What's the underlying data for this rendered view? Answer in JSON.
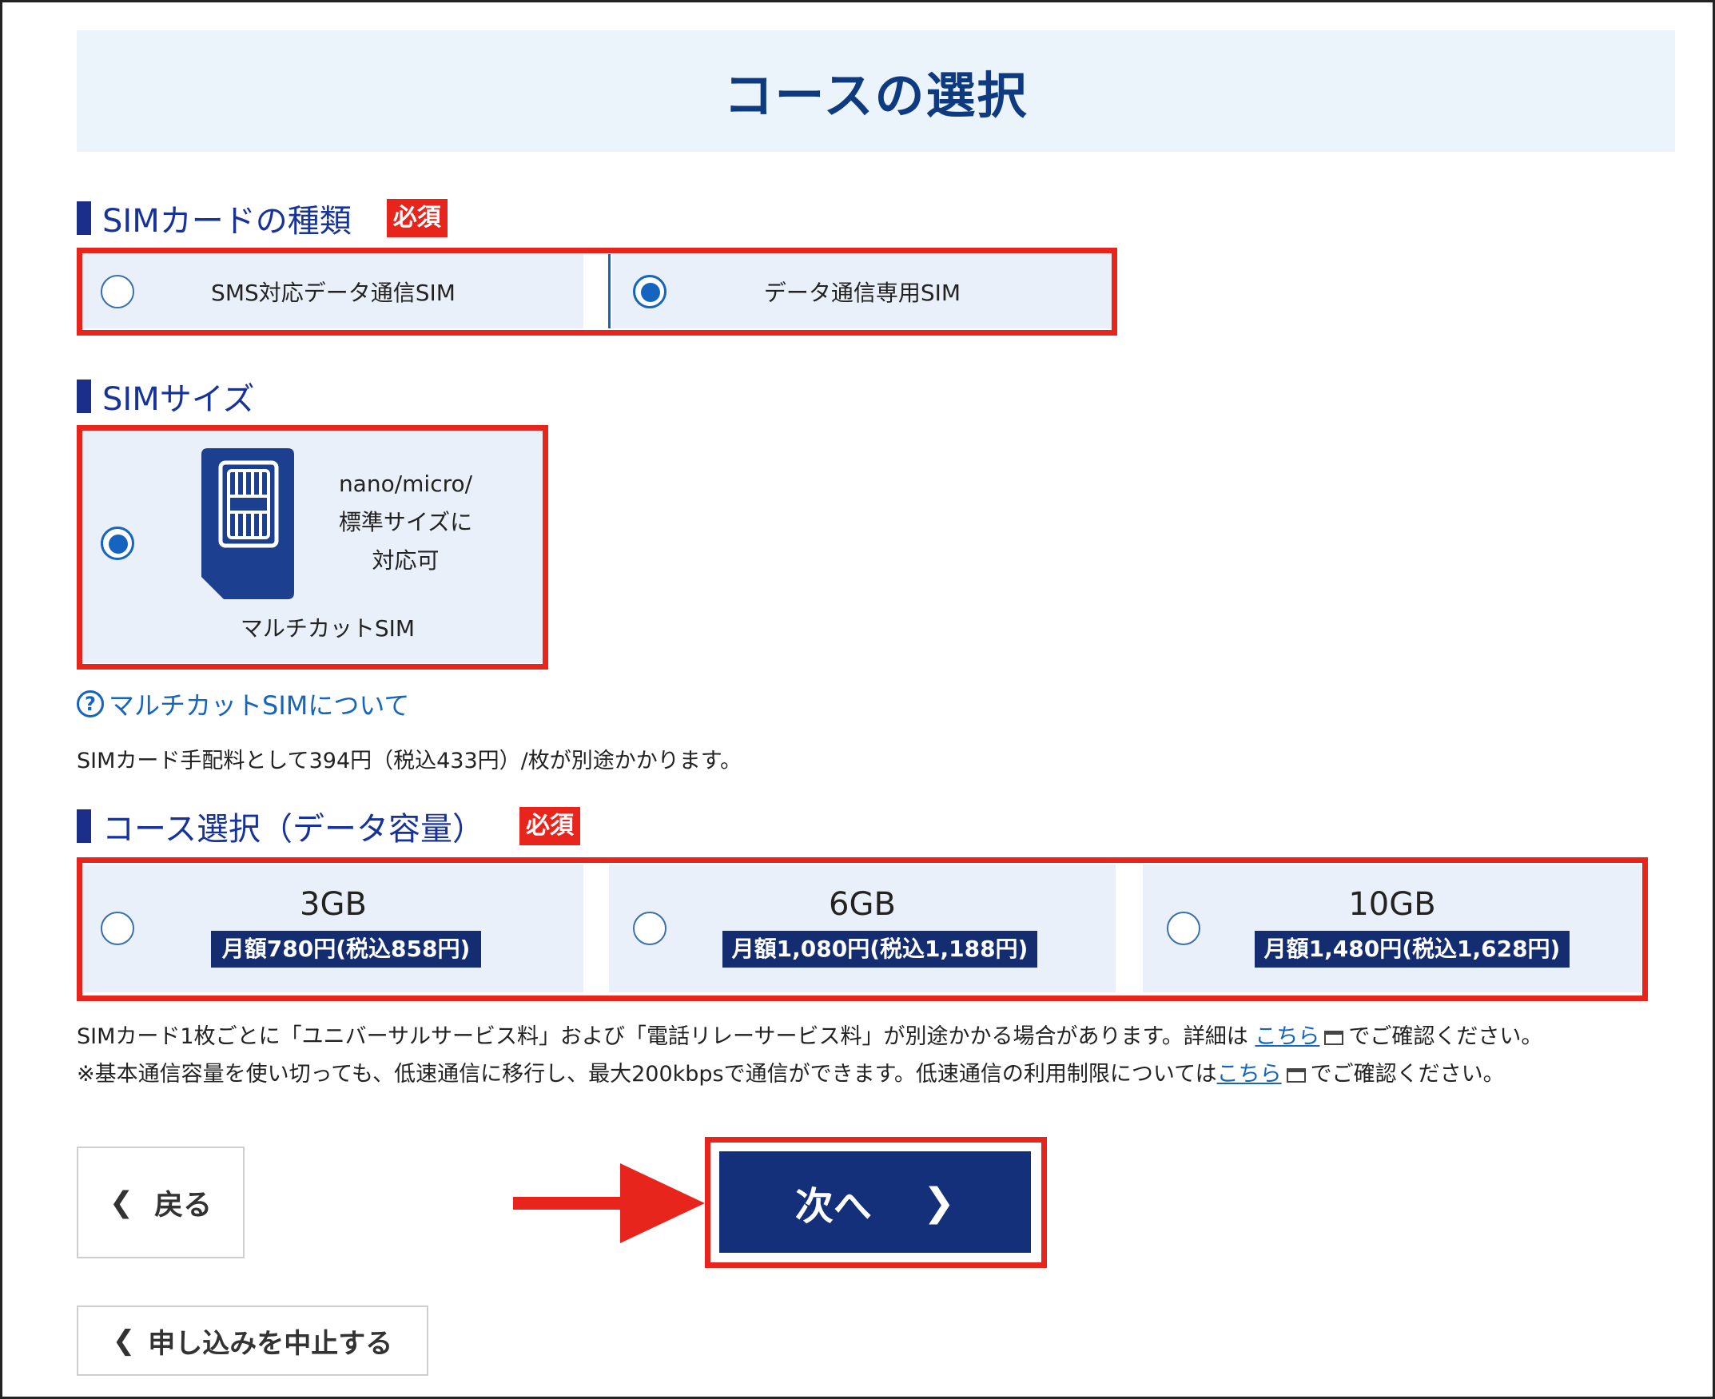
{
  "page": {
    "title": "コースの選択"
  },
  "sim_type": {
    "heading": "SIMカードの種類",
    "required": "必須",
    "options": [
      {
        "label": "SMS対応データ通信SIM",
        "selected": false
      },
      {
        "label": "データ通信専用SIM",
        "selected": true
      }
    ]
  },
  "sim_size": {
    "heading": "SIMサイズ",
    "option": {
      "description_lines": [
        "nano/micro/",
        "標準サイズに",
        "対応可"
      ],
      "name": "マルチカットSIM",
      "selected": true
    },
    "help_link": "マルチカットSIMについて",
    "fee_note": "SIMカード手配料として394円（税込433円）/枚が別途かかります。"
  },
  "course": {
    "heading": "コース選択（データ容量）",
    "required": "必須",
    "plans": [
      {
        "gb": "3GB",
        "price": "月額780円(税込858円)",
        "selected": false
      },
      {
        "gb": "6GB",
        "price": "月額1,080円(税込1,188円)",
        "selected": false
      },
      {
        "gb": "10GB",
        "price": "月額1,480円(税込1,628円)",
        "selected": false
      }
    ],
    "note1_before": "SIMカード1枚ごとに「ユニバーサルサービス料」および「電話リレーサービス料」が別途かかる場合があります。詳細は ",
    "note1_link": "こちら",
    "note1_after": "でご確認ください。",
    "note2_before": "※基本通信容量を使い切っても、低速通信に移行し、最大200kbpsで通信ができます。低速通信の利用制限については",
    "note2_link": "こちら",
    "note2_after": "でご確認ください。"
  },
  "buttons": {
    "back": "戻る",
    "next": "次へ",
    "cancel": "申し込みを中止する"
  },
  "colors": {
    "highlight": "#e8251c",
    "navy": "#14307a",
    "link": "#1565c0",
    "option_bg": "#e9f0fa"
  }
}
